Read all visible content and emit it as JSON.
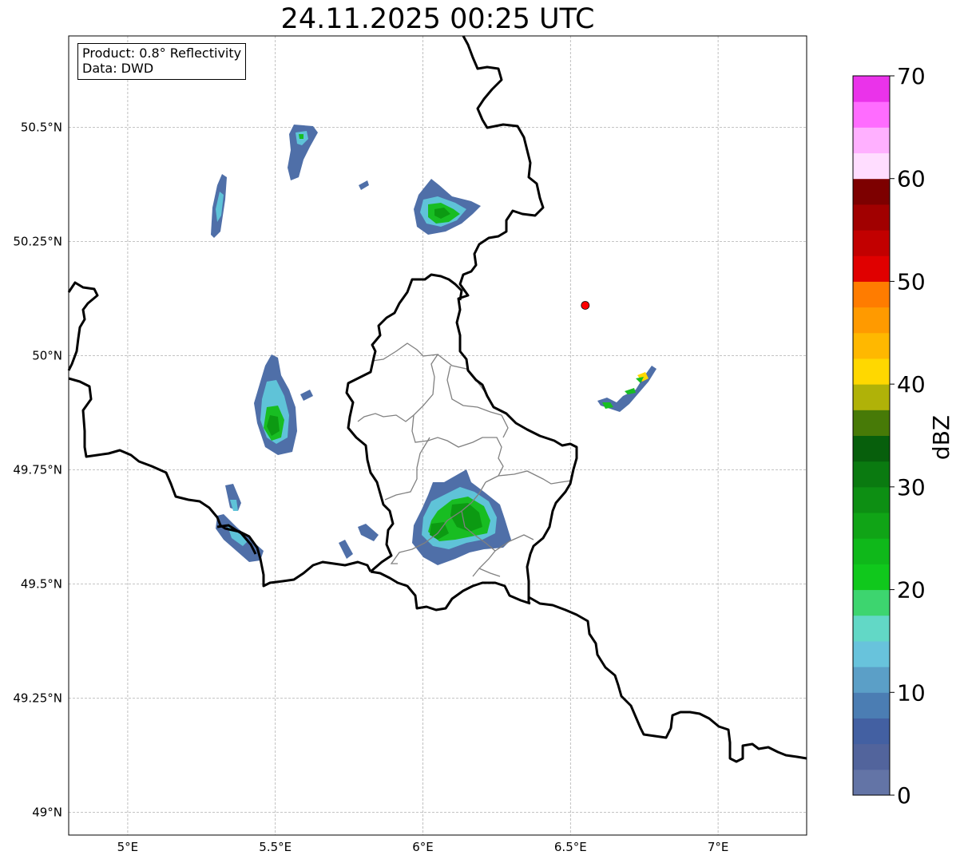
{
  "title": "24.11.2025 00:25 UTC",
  "info": {
    "product": "Product: 0.8° Reflectivity",
    "data": "Data: DWD"
  },
  "axes": {
    "lon_ticks": [
      {
        "value": 5.0,
        "label": "5°E"
      },
      {
        "value": 5.5,
        "label": "5.5°E"
      },
      {
        "value": 6.0,
        "label": "6°E"
      },
      {
        "value": 6.5,
        "label": "6.5°E"
      },
      {
        "value": 7.0,
        "label": "7°E"
      }
    ],
    "lat_ticks": [
      {
        "value": 50.5,
        "label": "50.5°N"
      },
      {
        "value": 50.25,
        "label": "50.25°N"
      },
      {
        "value": 50.0,
        "label": "50°N"
      },
      {
        "value": 49.75,
        "label": "49.75°N"
      },
      {
        "value": 49.5,
        "label": "49.5°N"
      },
      {
        "value": 49.25,
        "label": "49.25°N"
      },
      {
        "value": 49.0,
        "label": "49°N"
      }
    ],
    "lon_range": [
      4.8,
      7.3
    ],
    "lat_range": [
      48.95,
      50.7
    ],
    "grid": true
  },
  "colorbar": {
    "label": "dBZ",
    "min": 0,
    "max": 70,
    "ticks": [
      {
        "value": 0,
        "label": "0"
      },
      {
        "value": 10,
        "label": "10"
      },
      {
        "value": 20,
        "label": "20"
      },
      {
        "value": 30,
        "label": "30"
      },
      {
        "value": 40,
        "label": "40"
      },
      {
        "value": 50,
        "label": "50"
      },
      {
        "value": 60,
        "label": "60"
      },
      {
        "value": 70,
        "label": "70"
      }
    ],
    "colors": [
      "#6374a6",
      "#52649c",
      "#4360a2",
      "#4b7db3",
      "#5b9fc7",
      "#68c3dc",
      "#62d8c6",
      "#3dd56f",
      "#10c81c",
      "#0fb81a",
      "#10a416",
      "#0d8f13",
      "#0a7a10",
      "#075f0c",
      "#477a07",
      "#b0b208",
      "#ffd800",
      "#ffb800",
      "#ff9a00",
      "#ff7c00",
      "#e00000",
      "#c20000",
      "#a10000",
      "#7d0000",
      "#ffddff",
      "#ffb0ff",
      "#ff6cff",
      "#ea33ea"
    ]
  },
  "marker": {
    "lon": 6.55,
    "lat": 50.11,
    "color": "#ff0000"
  },
  "echo_colors": {
    "light": "#4f6fa8",
    "mid": "#5fc3d8",
    "strong": "#18bd22",
    "core": "#0c9a12"
  }
}
